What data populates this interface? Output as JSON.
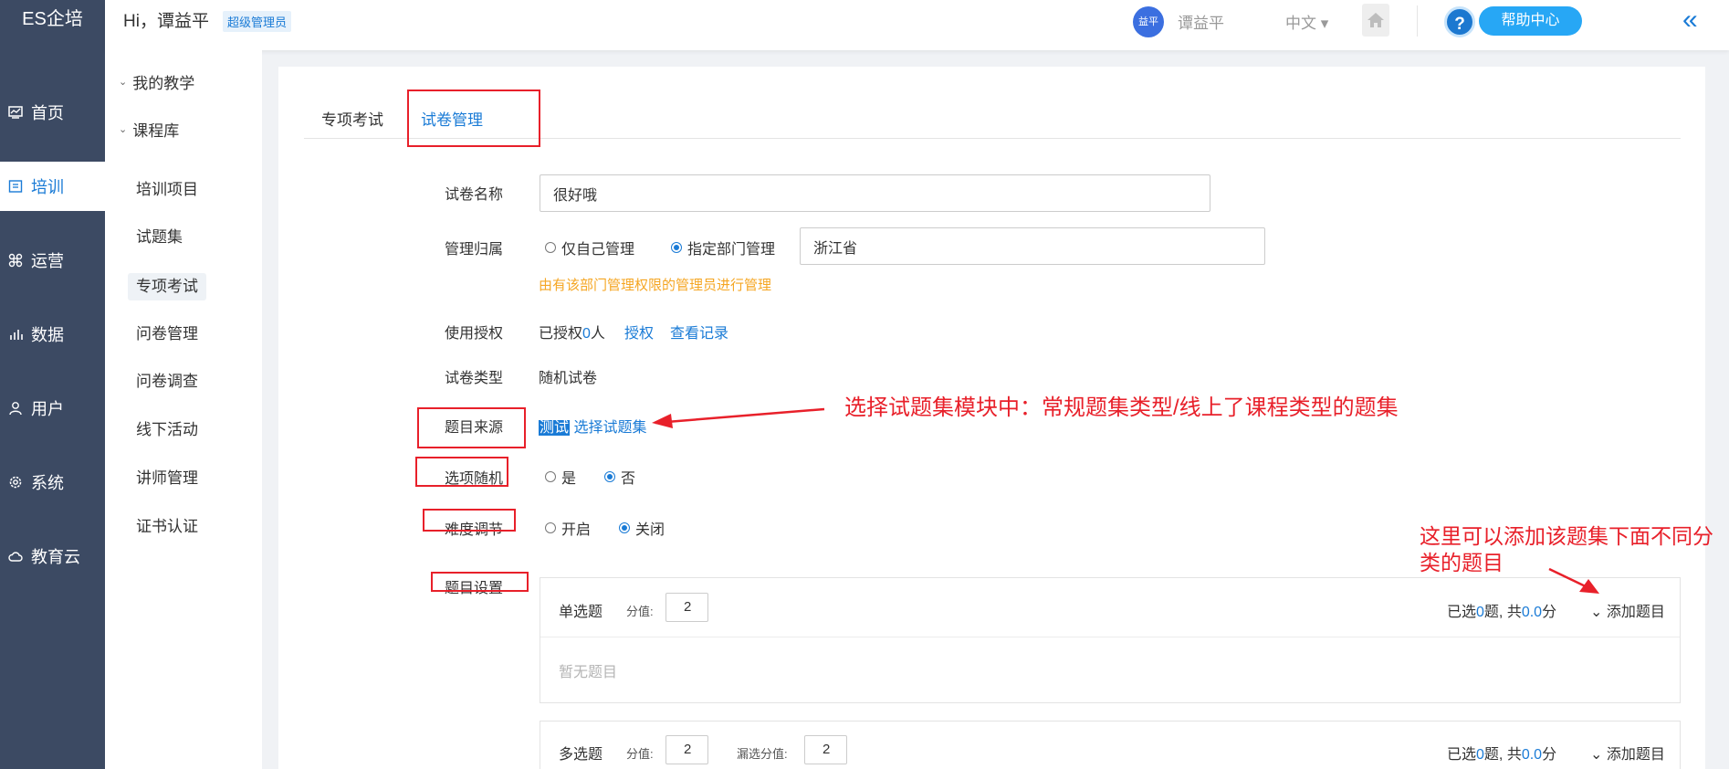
{
  "app": {
    "brand": "ES企培"
  },
  "leftnav": {
    "items": [
      {
        "label": "首页",
        "icon": "dashboard-icon"
      },
      {
        "label": "培训",
        "icon": "book-icon"
      },
      {
        "label": "运营",
        "icon": "command-icon"
      },
      {
        "label": "数据",
        "icon": "chart-icon"
      },
      {
        "label": "用户",
        "icon": "user-icon"
      },
      {
        "label": "系统",
        "icon": "gear-icon"
      },
      {
        "label": "教育云",
        "icon": "cloud-icon"
      }
    ]
  },
  "topbar": {
    "greeting": "Hi，谭益平",
    "role": "超级管理员",
    "avatar_text": "益平",
    "username": "谭益平",
    "language": "中文 ▾",
    "help_q": "?",
    "help_center": "帮助中心",
    "collapse": "«"
  },
  "subnav": {
    "group1": "我的教学",
    "group2": "课程库",
    "items": [
      "培训项目",
      "试题集",
      "专项考试",
      "问卷管理",
      "问卷调查",
      "线下活动",
      "讲师管理",
      "证书认证"
    ]
  },
  "tabs": [
    "专项考试",
    "试卷管理"
  ],
  "form": {
    "name_label": "试卷名称",
    "name_value": "很好哦",
    "owner_label": "管理归属",
    "owner_opt1": "仅自己管理",
    "owner_opt2": "指定部门管理",
    "owner_dept": "浙江省",
    "owner_hint": "由有该部门管理权限的管理员进行管理",
    "auth_label": "使用授权",
    "auth_prefix": "已授权",
    "auth_count": "0",
    "auth_suffix": "人",
    "auth_link": "授权",
    "auth_record": "查看记录",
    "type_label": "试卷类型",
    "type_value": "随机试卷",
    "source_label": "题目来源",
    "source_value": "测试",
    "source_link": "选择试题集",
    "random_label": "选项随机",
    "random_yes": "是",
    "random_no": "否",
    "difficulty_label": "难度调节",
    "difficulty_on": "开启",
    "difficulty_off": "关闭",
    "settings_label": "题目设置"
  },
  "questions": [
    {
      "title": "单选题",
      "score_label": "分值:",
      "score": "2",
      "stat_prefix": "已选",
      "stat_count": "0",
      "stat_mid": "题, 共",
      "stat_total": "0.0",
      "stat_suffix": "分",
      "add": "⌄ 添加题目",
      "empty": "暂无题目"
    },
    {
      "title": "多选题",
      "score_label": "分值:",
      "score": "2",
      "miss_label": "漏选分值:",
      "miss_score": "2",
      "stat_prefix": "已选",
      "stat_count": "0",
      "stat_mid": "题, 共",
      "stat_total": "0.0",
      "stat_suffix": "分",
      "add": "⌄ 添加题目"
    }
  ],
  "annotations": {
    "source_note": "选择试题集模块中：常规题集类型/线上了课程类型的题集",
    "add_note": "这里可以添加该题集下面不同分类的题目"
  },
  "colors": {
    "sidebar": "#3c4a63",
    "accent": "#1a7bd6",
    "annotation": "#e8202a",
    "hint": "#f5a623"
  }
}
